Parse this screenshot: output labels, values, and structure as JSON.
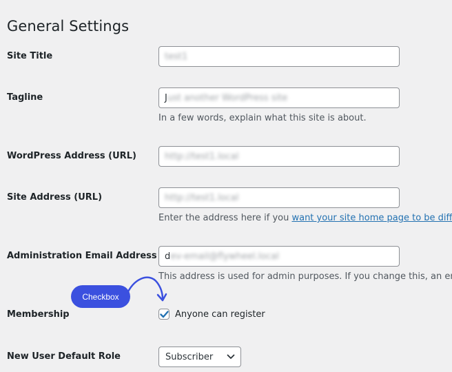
{
  "page": {
    "title": "General Settings"
  },
  "fields": {
    "site_title": {
      "label": "Site Title",
      "value_first": "",
      "value_blurred": "test1"
    },
    "tagline": {
      "label": "Tagline",
      "value_first": "J",
      "value_blurred": "ust another WordPress site",
      "description": "In a few words, explain what this site is about."
    },
    "wp_address": {
      "label": "WordPress Address (URL)",
      "value_first": "",
      "value_blurred": "http://test1.local"
    },
    "site_address": {
      "label": "Site Address (URL)",
      "value_first": "",
      "value_blurred": "http://test1.local",
      "description_prefix": "Enter the address here if you ",
      "description_link": "want your site home page to be differen"
    },
    "admin_email": {
      "label": "Administration Email Address",
      "value_first": "d",
      "value_blurred": "ev-email@flywheel.local",
      "description": "This address is used for admin purposes. If you change this, an email"
    },
    "membership": {
      "label": "Membership",
      "checkbox_label": "Anyone can register",
      "checked": true
    },
    "default_role": {
      "label": "New User Default Role",
      "selected": "Subscriber"
    }
  },
  "annotation": {
    "label": "Checkbox",
    "color": "#3b50df"
  },
  "colors": {
    "link": "#2271b1",
    "checkbox_check": "#2271b1"
  }
}
